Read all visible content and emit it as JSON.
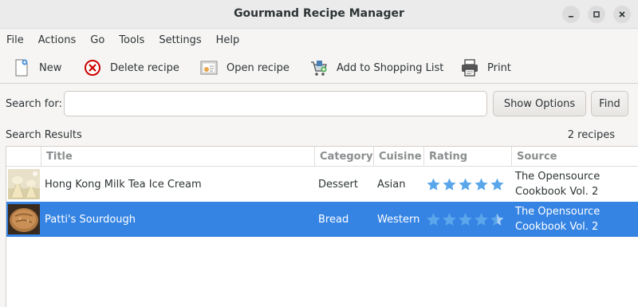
{
  "window": {
    "title": "Gourmand Recipe Manager"
  },
  "menu": [
    "File",
    "Actions",
    "Go",
    "Tools",
    "Settings",
    "Help"
  ],
  "toolbar": {
    "new_label": "New",
    "delete_label": "Delete recipe",
    "open_label": "Open recipe",
    "shopping_label": "Add to Shopping List",
    "print_label": "Print"
  },
  "search": {
    "label": "Search for:",
    "value": "",
    "show_options_label": "Show Options",
    "find_label": "Find"
  },
  "results": {
    "label": "Search Results",
    "count": "2 recipes",
    "columns": [
      "Title",
      "Category",
      "Cuisine",
      "Rating",
      "Source"
    ],
    "rows": [
      {
        "title": "Hong Kong Milk Tea Ice Cream",
        "category": "Dessert",
        "cuisine": "Asian",
        "rating": 5,
        "source_line1": "The Opensource",
        "source_line2": "Cookbook Vol. 2",
        "selected": false
      },
      {
        "title": "Patti's Sourdough",
        "category": "Bread",
        "cuisine": "Western",
        "rating": 4.5,
        "source_line1": "The Opensource",
        "source_line2": "Cookbook Vol. 2",
        "selected": true
      }
    ]
  },
  "colors": {
    "selection": "#3584e4",
    "star": "#5aa6ea",
    "star_empty": "#a9d0f5"
  }
}
